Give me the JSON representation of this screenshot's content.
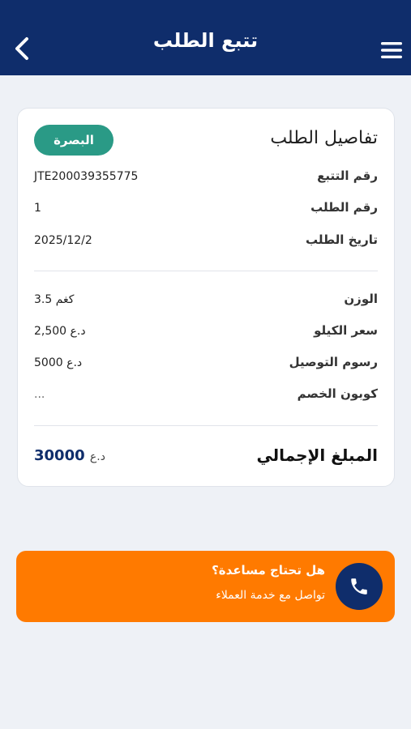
{
  "header": {
    "title": "تتبع الطلب",
    "back_icon": "chevron-left-icon",
    "menu_icon": "hamburger-menu-icon"
  },
  "order_card": {
    "title": "تفاصيل الطلب",
    "city_badge": "البصرة",
    "details": [
      {
        "label": "رقم التتبع",
        "value": "JTE200039355775"
      },
      {
        "label": "رقم الطلب",
        "value": "1"
      },
      {
        "label": "تاريخ الطلب",
        "value": "2025/12/2"
      }
    ],
    "pricing": [
      {
        "label": "الوزن",
        "value": "3.5 كغم"
      },
      {
        "label": "سعر الكيلو",
        "value": "2,500 د.ع"
      },
      {
        "label": "رسوم التوصيل",
        "value": "5000 د.ع"
      },
      {
        "label": "كوبون الخصم",
        "value": "..."
      }
    ],
    "total_label": "المبلغ الإجمالي",
    "total_amount": "30000",
    "total_currency": "د.ع"
  },
  "help": {
    "title": "هل تحتاج مساعدة؟",
    "subtitle": "تواصل مع خدمة العملاء",
    "icon": "phone-icon"
  },
  "colors": {
    "header_bg": "#0f2d6b",
    "badge_bg": "#2a9a86",
    "help_bg": "#ff7a00",
    "page_bg": "#eef1f6"
  }
}
